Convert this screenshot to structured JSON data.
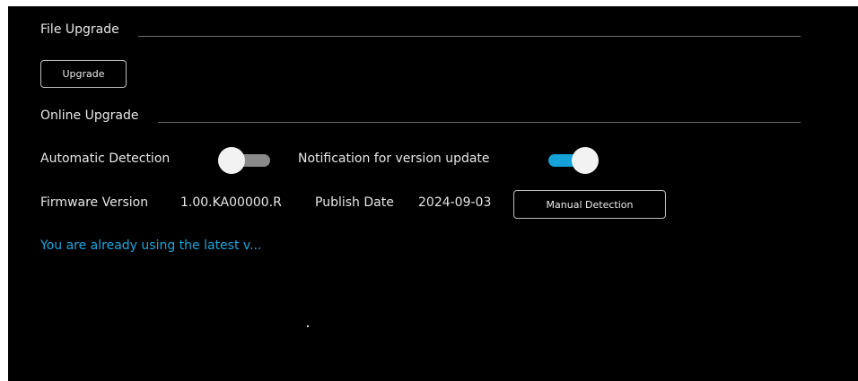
{
  "file_upgrade": {
    "title": "File Upgrade",
    "upgrade_button": "Upgrade"
  },
  "online_upgrade": {
    "title": "Online Upgrade",
    "automatic_detection_label": "Automatic Detection",
    "automatic_detection_enabled": false,
    "notification_label": "Notification for version update",
    "notification_enabled": true,
    "firmware_version_label": "Firmware Version",
    "firmware_version_value": "1.00.KA00000.R",
    "publish_date_label": "Publish Date",
    "publish_date_value": "2024-09-03",
    "manual_detection_button": "Manual Detection",
    "status_message": "You are already using the latest v..."
  },
  "colors": {
    "background": "#000000",
    "accent": "#14a2d8",
    "status_text": "#1ca5dd"
  }
}
